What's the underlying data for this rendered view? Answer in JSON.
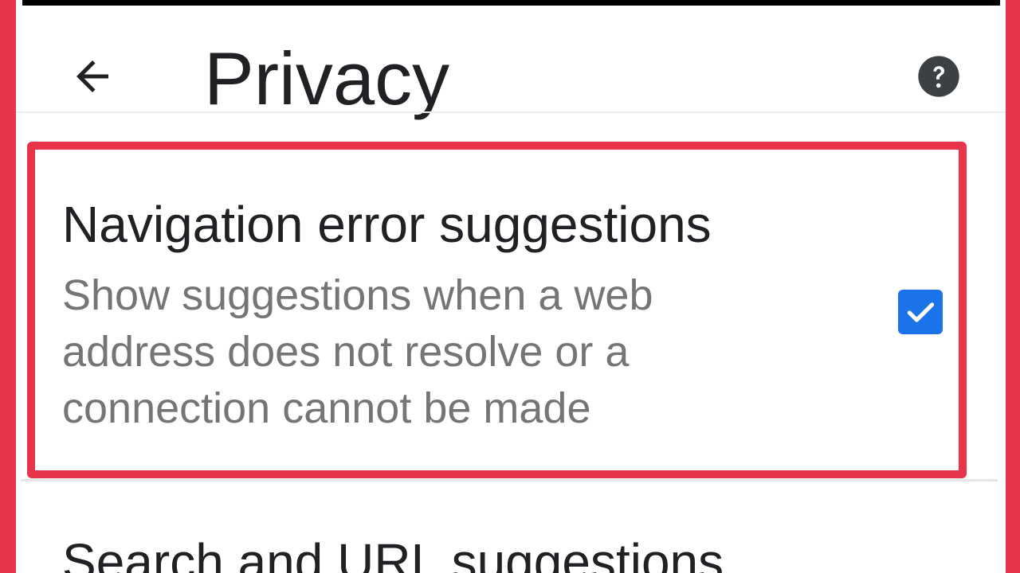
{
  "header": {
    "title": "Privacy",
    "back_icon": "arrow-back-icon",
    "help_icon": "help-circle-icon"
  },
  "settings": [
    {
      "title": "Navigation error suggestions",
      "summary": "Show suggestions when a web address does not resolve or a connection cannot be made",
      "checked": true
    },
    {
      "title": "Search and URL suggestions"
    }
  ],
  "colors": {
    "highlight": "#e8344a",
    "checkbox": "#1a73e8",
    "title_text": "#202124",
    "summary_text": "#757575"
  }
}
